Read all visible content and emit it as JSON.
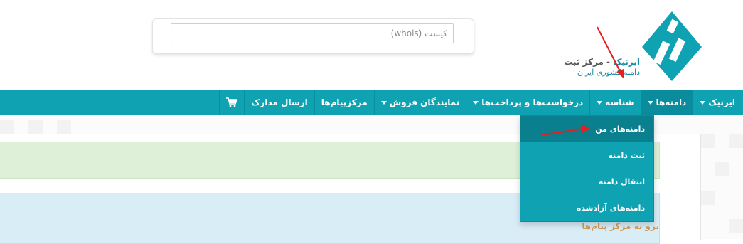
{
  "header": {
    "search_placeholder": "کیست (whois)",
    "brand_title_main": "ایرنیک",
    "brand_title_sep": " - ",
    "brand_title_sub": "مرکز ثبت",
    "brand_subtitle": "دامنه کشوری ایران"
  },
  "nav": {
    "items": [
      {
        "label": "ایرنیک",
        "has_caret": true
      },
      {
        "label": "دامنه‌ها",
        "has_caret": true
      },
      {
        "label": "شناسه",
        "has_caret": true
      },
      {
        "label": "درخواست‌ها و پرداخت‌ها",
        "has_caret": true
      },
      {
        "label": "نمایندگان فروش",
        "has_caret": true
      },
      {
        "label": "مرکزپیام‌ها",
        "has_caret": false
      },
      {
        "label": "ارسال مدارک",
        "has_caret": false
      }
    ],
    "cart_icon": "shopping-cart-icon"
  },
  "dropdown": {
    "items": [
      {
        "label": "دامنه‌های من"
      },
      {
        "label": "ثبت دامنه"
      },
      {
        "label": "انتقال دامنه"
      },
      {
        "label": "دامنه‌های آزادشده"
      }
    ]
  },
  "content": {
    "message_link": "برو به مرکز پیام‌ها"
  },
  "colors": {
    "navbar": "#0ea2b3",
    "dropdown_active": "#0a7f8e",
    "annotation_arrow": "#e32020",
    "alert_success": "#dff0d8",
    "alert_info": "#d9edf7",
    "link": "#cf9b5a"
  }
}
